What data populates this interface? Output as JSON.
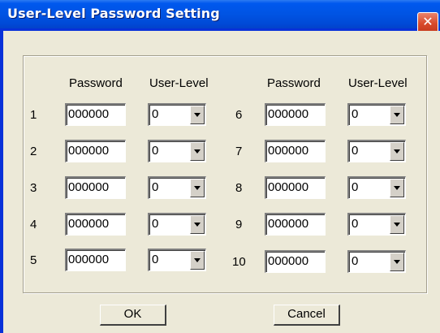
{
  "window": {
    "title": "User-Level Password Setting",
    "close_label": "✕"
  },
  "headers": {
    "password": "Password",
    "user_level": "User-Level"
  },
  "rows": [
    {
      "num": "1",
      "password": "000000",
      "level": "0"
    },
    {
      "num": "2",
      "password": "000000",
      "level": "0"
    },
    {
      "num": "3",
      "password": "000000",
      "level": "0"
    },
    {
      "num": "4",
      "password": "000000",
      "level": "0"
    },
    {
      "num": "5",
      "password": "000000",
      "level": "0"
    },
    {
      "num": "6",
      "password": "000000",
      "level": "0"
    },
    {
      "num": "7",
      "password": "000000",
      "level": "0"
    },
    {
      "num": "8",
      "password": "000000",
      "level": "0"
    },
    {
      "num": "9",
      "password": "000000",
      "level": "0"
    },
    {
      "num": "10",
      "password": "000000",
      "level": "0"
    }
  ],
  "buttons": {
    "ok": "OK",
    "cancel": "Cancel"
  },
  "colors": {
    "title_bar": "#0054e3",
    "close_button": "#d94a2b",
    "dialog_face": "#ece9d8"
  }
}
